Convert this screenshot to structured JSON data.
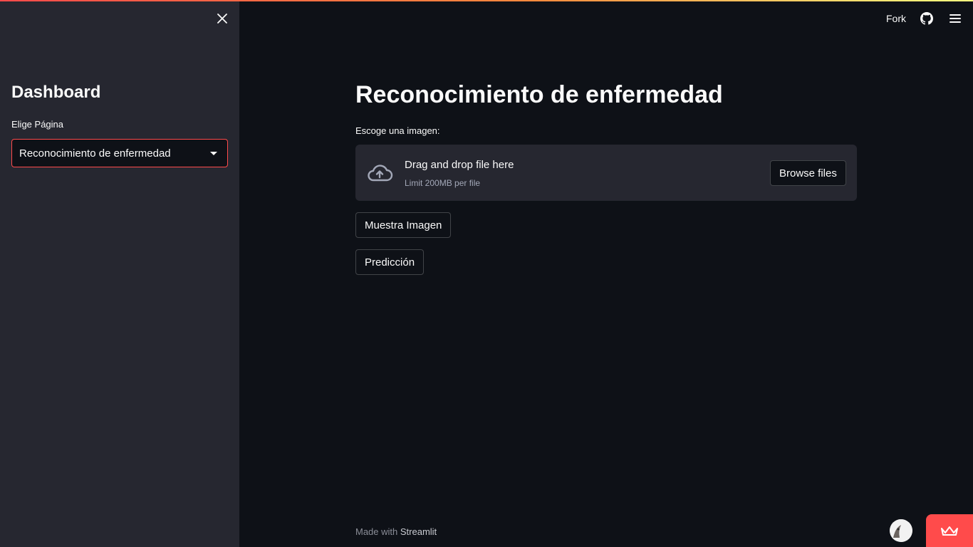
{
  "sidebar": {
    "title": "Dashboard",
    "select_label": "Elige Página",
    "select_value": "Reconocimiento de enfermedad",
    "close_icon": "close-icon"
  },
  "header": {
    "fork_label": "Fork",
    "github_icon": "github-icon",
    "menu_icon": "hamburger-menu-icon"
  },
  "main": {
    "title": "Reconocimiento de enfermedad",
    "uploader": {
      "label": "Escoge una imagen:",
      "drop_text": "Drag and drop file here",
      "limit_text": "Limit 200MB per file",
      "browse_label": "Browse files",
      "icon": "cloud-upload-icon"
    },
    "buttons": {
      "show_image": "Muestra Imagen",
      "predict": "Predicción"
    }
  },
  "footer": {
    "made_with": "Made with",
    "brand": "Streamlit"
  },
  "colors": {
    "background": "#0e1117",
    "sidebar": "#262730",
    "accent": "#ff4b4b",
    "text": "#fafafa"
  }
}
